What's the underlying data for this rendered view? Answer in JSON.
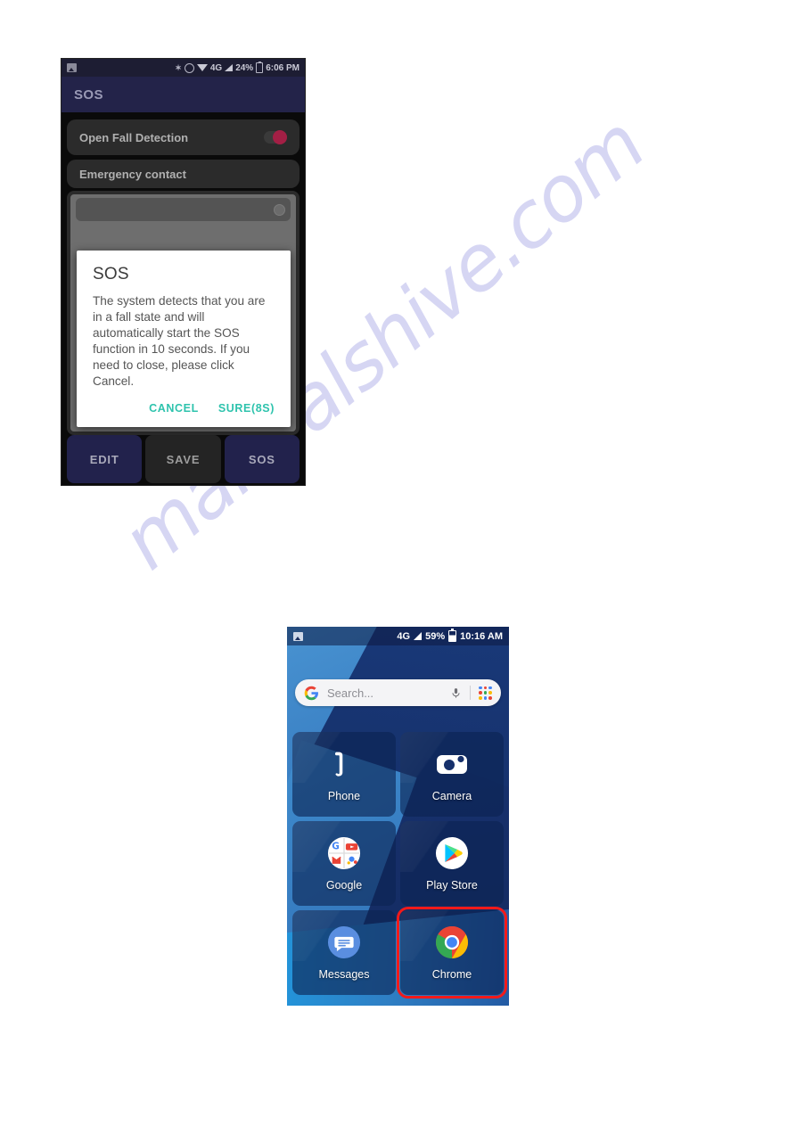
{
  "watermark": {
    "text": "manualshive.com",
    "color": "#c9c9f0"
  },
  "phone_sos": {
    "status_bar": {
      "screenshot_icon": "screenshot-icon",
      "bluetooth_icon": "bluetooth-icon",
      "alarm_icon": "alarm-icon",
      "wifi_icon": "wifi-icon",
      "network_label": "4G",
      "signal_icon": "signal-icon",
      "battery_percent": "24%",
      "battery_icon": "battery-icon",
      "time": "6:06 PM"
    },
    "app_bar": {
      "title": "SOS"
    },
    "rows": {
      "fall_detection_label": "Open Fall Detection",
      "fall_detection_toggle_state": "on",
      "toggle_color": "#a31f45",
      "emergency_contact_label": "Emergency contact"
    },
    "dialog": {
      "title": "SOS",
      "message": "The system detects that you are in a fall state and will automatically start the SOS function in 10 seconds. If you need to close, please click Cancel.",
      "cancel_label": "CANCEL",
      "confirm_label": "SURE(8S)",
      "action_color": "#2ec3ad"
    },
    "bottom_buttons": [
      {
        "label": "EDIT",
        "style": "navy"
      },
      {
        "label": "SAVE",
        "style": "dark"
      },
      {
        "label": "SOS",
        "style": "navy"
      }
    ]
  },
  "phone_home": {
    "status_bar": {
      "screenshot_icon": "screenshot-icon",
      "network_label": "4G",
      "signal_icon": "signal-icon",
      "battery_percent": "59%",
      "battery_icon": "battery-icon",
      "time": "10:16 AM"
    },
    "search": {
      "placeholder": "Search...",
      "google_icon": "google-g-icon",
      "mic_icon": "microphone-icon",
      "apps_icon": "apps-grid-icon"
    },
    "apps": [
      {
        "label": "Phone",
        "icon": "phone-icon",
        "highlighted": false
      },
      {
        "label": "Camera",
        "icon": "camera-icon",
        "highlighted": false
      },
      {
        "label": "Google",
        "icon": "google-folder-icon",
        "highlighted": false
      },
      {
        "label": "Play Store",
        "icon": "play-store-icon",
        "highlighted": false
      },
      {
        "label": "Messages",
        "icon": "messages-icon",
        "highlighted": false
      },
      {
        "label": "Chrome",
        "icon": "chrome-icon",
        "highlighted": true
      }
    ],
    "highlight_color": "#f21a1a"
  }
}
